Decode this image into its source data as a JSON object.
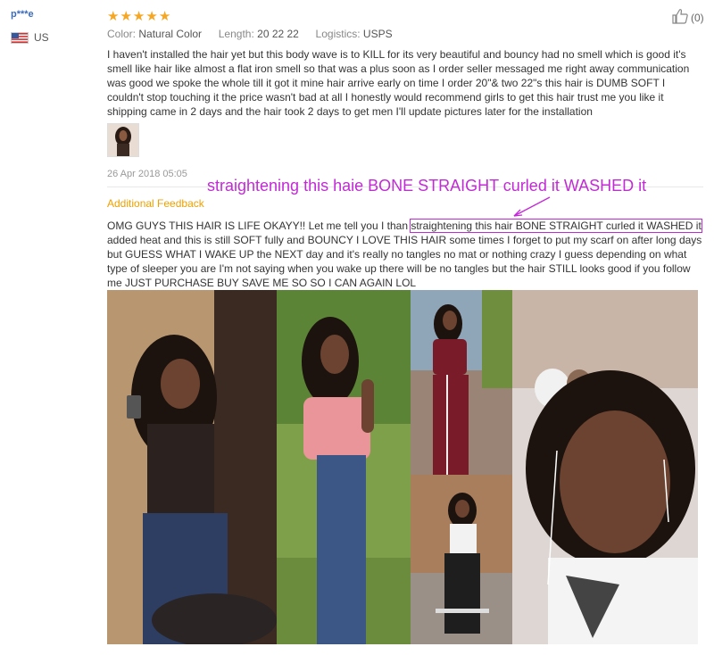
{
  "reviewer": {
    "name": "p***e",
    "country": "US"
  },
  "rating": {
    "stars": 5,
    "max": 5
  },
  "like": {
    "count": "(0)"
  },
  "meta": {
    "color_label": "Color:",
    "color_value": "Natural Color",
    "length_label": "Length:",
    "length_value": "20 22 22",
    "logistics_label": "Logistics:",
    "logistics_value": "USPS"
  },
  "review_text": "I haven't installed the hair yet but this body wave is to KILL for its very beautiful and bouncy had no smell which is good it's smell like hair like almost a flat iron smell so that was a plus soon as I order seller messaged me right away communication was good we spoke the whole till it got it mine hair arrive early on time I order 20\"& two 22\"s this hair is DUMB SOFT I couldn't stop touching it the price wasn't bad at all I honestly would recommend girls to get this hair trust me you like it shipping came in 2 days and the hair took 2 days to get men I'll update pictures later for the installation",
  "review_date": "26 Apr 2018 05:05",
  "additional_feedback_label": "Additional Feedback",
  "callout_text": "straightening this haie BONE STRAIGHT curled it WASHED it",
  "feedback": {
    "before": "OMG GUYS THIS HAIR IS LIFE OKAYY!! Let me tell you I than ",
    "highlight": "straightening this hair BONE STRAIGHT curled it WASHED it",
    "after": " added heat and this is still SOFT fully and BOUNCY I LOVE THIS HAIR some times I forget to put my scarf on after long days but GUESS WHAT I WAKE UP the NEXT day and it's really no tangles no mat or nothing crazy I guess depending on what type of sleeper you are I'm not saying when you wake up there will be no tangles but the hair STILL looks good if you follow me JUST PURCHASE BUY SAVE ME SO SO I CAN AGAIN LOL"
  },
  "icons": {
    "flag": "us-flag-icon",
    "star": "star-icon",
    "like": "thumbs-up-icon"
  },
  "colors": {
    "star": "#f5a623",
    "username": "#3d6cb8",
    "accent": "#f0a000",
    "callout": "#c12ad5"
  }
}
